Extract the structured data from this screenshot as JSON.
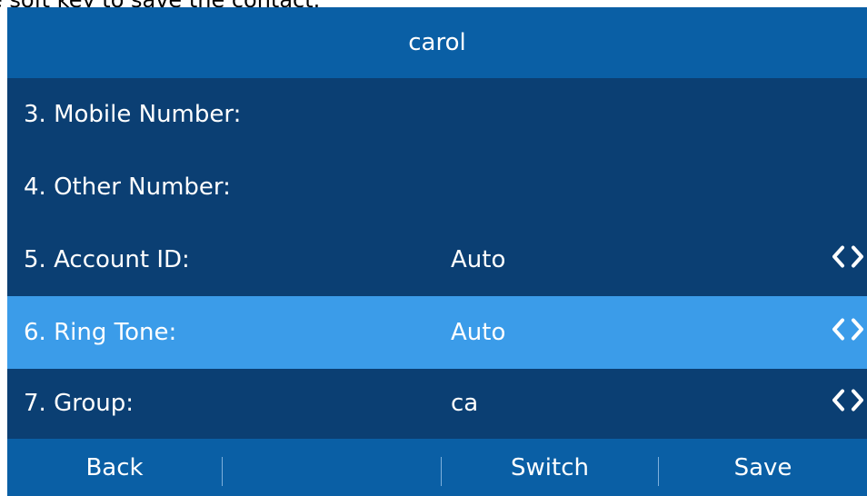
{
  "caption": "e soft key to save the contact.",
  "title": "carol",
  "rows": [
    {
      "label": "3. Mobile Number:",
      "value": ""
    },
    {
      "label": "4. Other Number:",
      "value": ""
    },
    {
      "label": "5. Account ID:",
      "value": "Auto"
    },
    {
      "label": "6. Ring Tone:",
      "value": "Auto",
      "selected": true
    },
    {
      "label": "7. Group:",
      "value": "ca"
    }
  ],
  "softkeys": {
    "back": "Back",
    "slot2": "",
    "switch": "Switch",
    "save": "Save"
  },
  "icons": {
    "left": "chevron-left-icon",
    "right": "chevron-right-icon"
  },
  "colors": {
    "background": "#0b3f73",
    "header": "#0a5fa5",
    "selected": "#3b9ce9"
  }
}
